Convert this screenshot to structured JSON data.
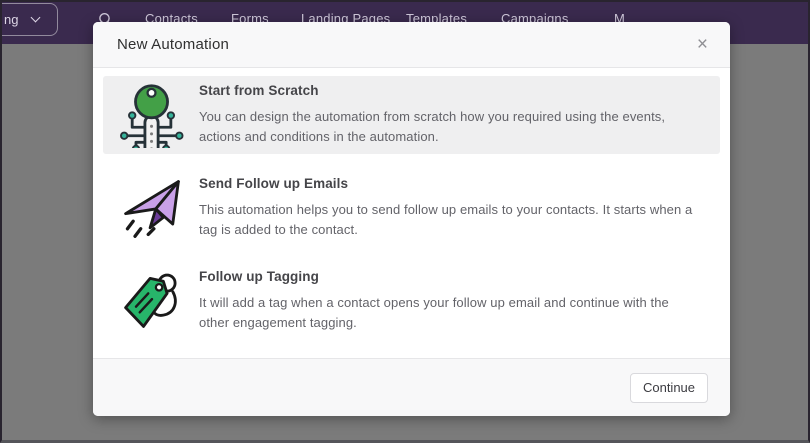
{
  "navbar": {
    "dropdown": {
      "label": "ng"
    },
    "search_icon": "magnifier",
    "items": [
      {
        "label": "Contacts"
      },
      {
        "label": "Forms"
      },
      {
        "label": "Landing Pages"
      },
      {
        "label": "Templates"
      },
      {
        "label": "Campaigns"
      },
      {
        "label": "M"
      }
    ]
  },
  "modal": {
    "title": "New Automation",
    "close_label": "×",
    "options": [
      {
        "icon": "key-circuit-icon",
        "selected": true,
        "title": "Start from Scratch",
        "description": "You can design the automation from scratch how you required using the events, actions and conditions in the automation."
      },
      {
        "icon": "paper-plane-icon",
        "selected": false,
        "title": "Send Follow up Emails",
        "description": "This automation helps you to send follow up emails to your contacts. It starts when a tag is added to the contact."
      },
      {
        "icon": "tag-icon",
        "selected": false,
        "title": "Follow up Tagging",
        "description": "It will add a tag when a contact opens your follow up email and continue with the other engagement tagging."
      }
    ],
    "footer": {
      "continue_label": "Continue"
    }
  },
  "colors": {
    "navbar": "#3a2a4e",
    "overlay": "#7b7b7b",
    "selected_row": "#efeff0",
    "key_green": "#43a047",
    "plane_purple": "#c9a0e8",
    "plane_dark_purple": "#6c3d99",
    "tag_green": "#27b56a"
  }
}
